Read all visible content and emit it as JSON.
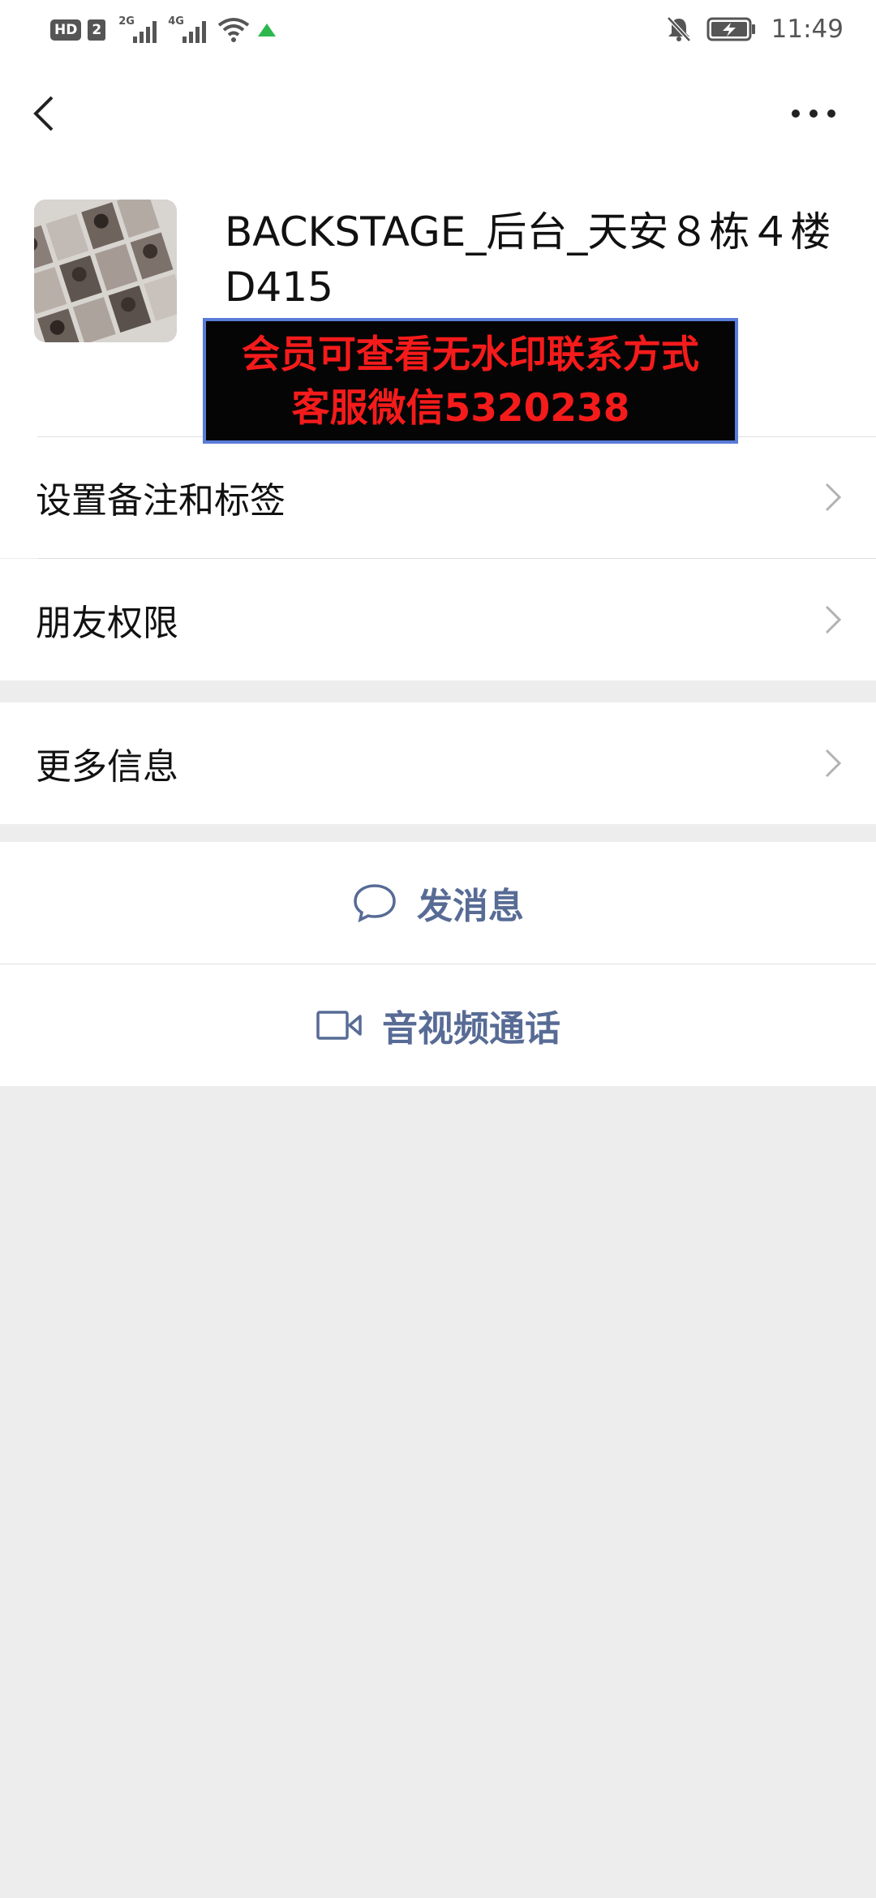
{
  "status_bar": {
    "hd_label": "HD",
    "sim_label": "2",
    "network_1": "2G",
    "network_2": "4G",
    "time": "11:49",
    "icons": [
      "wifi-icon",
      "data-arrow-icon",
      "mute-bell-icon",
      "battery-charging-icon"
    ]
  },
  "nav": {
    "back_icon": "back-chevron-icon",
    "more_icon": "more-dots-icon"
  },
  "profile": {
    "name": "BACKSTAGE_后台_天安８栋４楼D415",
    "watermark_line1": "会员可查看无水印联系方式",
    "watermark_line2": "客服微信5320238"
  },
  "menu": {
    "remarks_label": "设置备注和标签",
    "permissions_label": "朋友权限",
    "more_info_label": "更多信息"
  },
  "actions": {
    "message_label": "发消息",
    "call_label": "音视频通话"
  },
  "colors": {
    "link_blue": "#576b95",
    "watermark_red": "#f51b1b",
    "background": "#ededed"
  }
}
